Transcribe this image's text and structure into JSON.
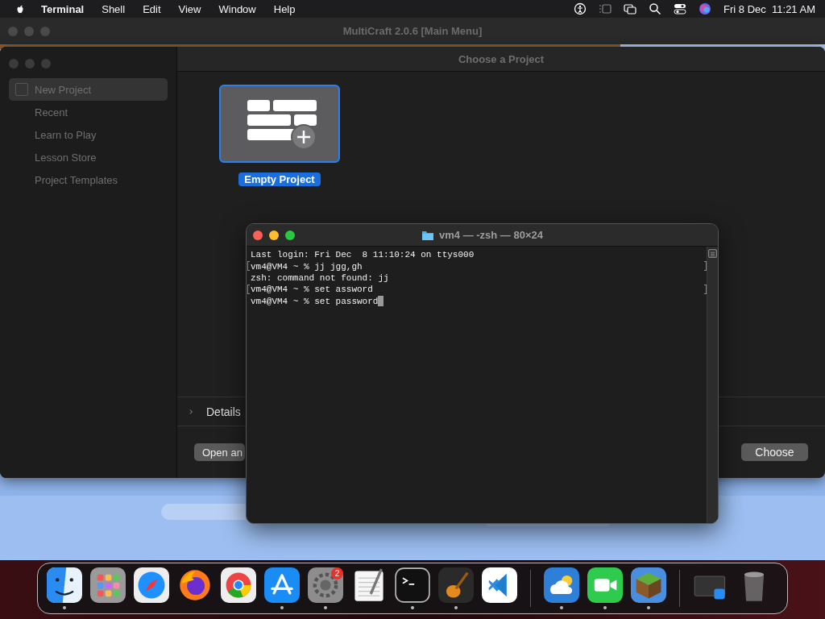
{
  "menu_bar": {
    "app": "Terminal",
    "menus": [
      "Shell",
      "Edit",
      "View",
      "Window",
      "Help"
    ],
    "date": "Fri 8 Dec",
    "time": "11:21 AM"
  },
  "main_window": {
    "title": "MultiCraft 2.0.6 [Main Menu]"
  },
  "project_dialog": {
    "title": "Choose a Project",
    "sidebar": [
      {
        "label": "New Project",
        "selected": true
      },
      {
        "label": "Recent",
        "selected": false
      },
      {
        "label": "Learn to Play",
        "selected": false
      },
      {
        "label": "Lesson Store",
        "selected": false
      },
      {
        "label": "Project Templates",
        "selected": false
      }
    ],
    "templates": [
      {
        "label": "Empty Project",
        "selected": true
      }
    ],
    "details": "Details",
    "buttons": [
      {
        "label": "Open an",
        "kind": "left"
      },
      {
        "label": "Choose",
        "kind": "right"
      }
    ]
  },
  "terminal": {
    "title": "vm4 — -zsh — 80×24",
    "lines": [
      {
        "text": "Last login: Fri Dec  8 11:10:24 on ttys000",
        "marked": false,
        "cursor": false
      },
      {
        "text": "vm4@VM4 ~ % jj jgg,gh",
        "marked": true,
        "cursor": false
      },
      {
        "text": "zsh: command not found: jj",
        "marked": false,
        "cursor": false
      },
      {
        "text": "vm4@VM4 ~ % set assword",
        "marked": true,
        "cursor": false
      },
      {
        "text": "vm4@VM4 ~ % set password",
        "marked": false,
        "cursor": true
      }
    ]
  },
  "dock": {
    "apps": [
      {
        "kind": "finder",
        "running": true
      },
      {
        "kind": "launchpad",
        "running": false
      },
      {
        "kind": "safari",
        "running": false
      },
      {
        "kind": "firefox",
        "running": false
      },
      {
        "kind": "chrome",
        "running": false
      },
      {
        "kind": "appstore",
        "running": true
      },
      {
        "kind": "settings",
        "running": true,
        "badge": "2"
      },
      {
        "kind": "textedit",
        "running": false
      },
      {
        "kind": "terminal",
        "running": true
      },
      {
        "kind": "garageband",
        "running": true
      },
      {
        "kind": "vscode",
        "running": false
      },
      {
        "kind": "separator"
      },
      {
        "kind": "weather",
        "running": true
      },
      {
        "kind": "facetime",
        "running": true
      },
      {
        "kind": "minecraft",
        "running": true
      },
      {
        "kind": "separator"
      },
      {
        "kind": "thumbnail",
        "running": false
      },
      {
        "kind": "trash",
        "running": false
      }
    ]
  }
}
